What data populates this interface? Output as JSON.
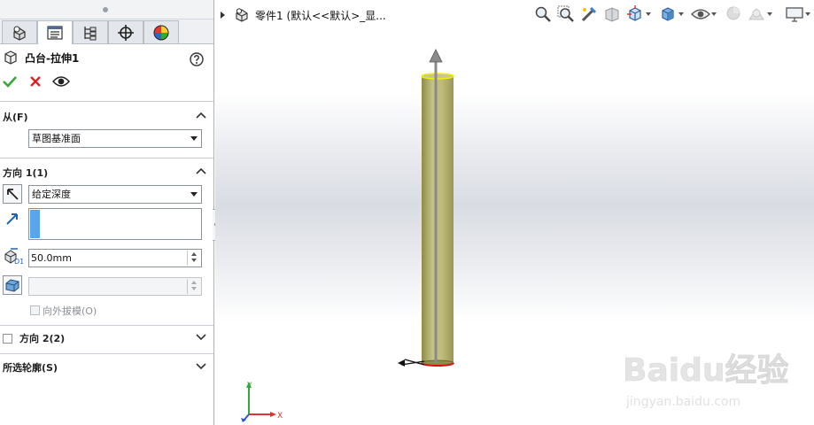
{
  "panel": {
    "feature_title": "凸台-拉伸1",
    "help_icon": "help-icon",
    "tabs": [
      {
        "name": "feature-manager-tab",
        "icon": "feature-tree-icon"
      },
      {
        "name": "property-manager-tab",
        "icon": "property-manager-icon"
      },
      {
        "name": "configuration-manager-tab",
        "icon": "configuration-icon"
      },
      {
        "name": "dimxpert-tab",
        "icon": "crosshair-icon"
      },
      {
        "name": "display-manager-tab",
        "icon": "appearance-icon"
      }
    ],
    "actions": {
      "ok": "confirm-icon",
      "cancel": "cancel-icon",
      "preview": "eye-icon"
    },
    "from": {
      "title": "从(F)",
      "start_condition": "草图基准面"
    },
    "direction1": {
      "title": "方向 1(1)",
      "end_condition": "给定深度",
      "depth": "50.0mm",
      "draft_outward_label": "向外拔模(O)"
    },
    "direction2": {
      "title": "方向 2(2)"
    },
    "selected_contours": {
      "title": "所选轮廓(S)"
    }
  },
  "viewport": {
    "breadcrumb": "零件1  (默认<<默认>_显...",
    "toolbar": [
      "zoom-to-fit-icon",
      "zoom-to-area-icon",
      "previous-view-icon",
      "section-view-icon",
      "view-orientation-icon",
      "display-style-icon",
      "hide-show-items-icon",
      "edit-appearance-icon",
      "apply-scene-icon",
      "view-settings-icon"
    ],
    "colors": {
      "cylinder": "#bdbb7a",
      "cylinder_shade": "#8f8c48",
      "top_edge": "#f2ef00",
      "arrow": "#808080"
    },
    "watermark": {
      "brand": "Baidu经验",
      "url": "jingyan.baidu.com"
    }
  }
}
